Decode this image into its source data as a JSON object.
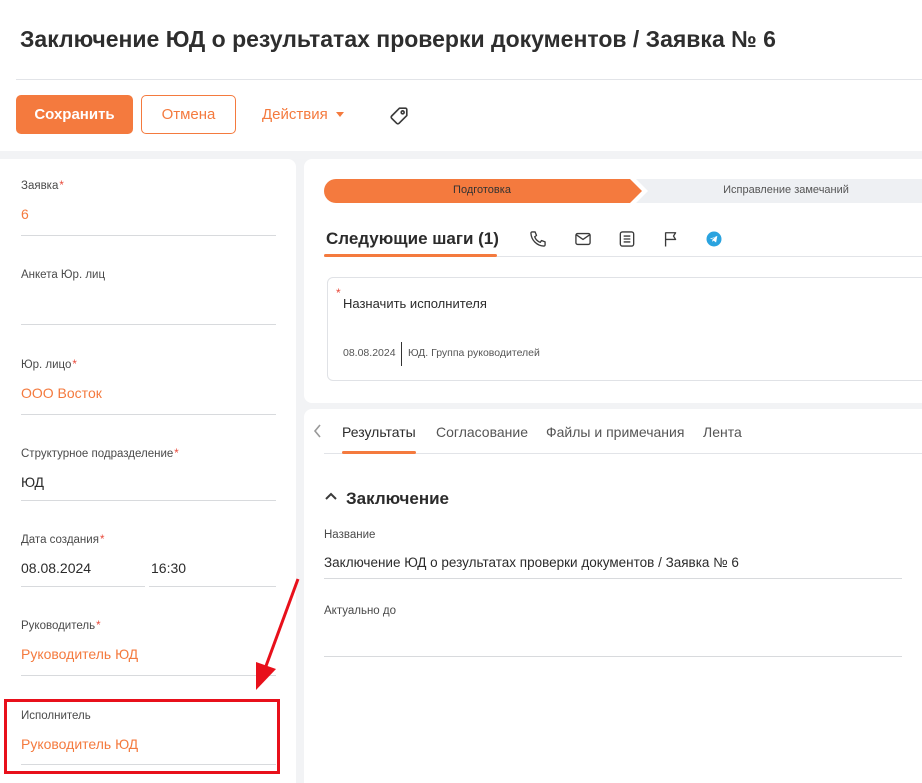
{
  "header": {
    "title": "Заключение ЮД о результатах проверки документов / Заявка № 6",
    "save_label": "Сохранить",
    "cancel_label": "Отмена",
    "actions_label": "Действия",
    "tag_icon": "tag-icon"
  },
  "left_form": {
    "fields": [
      {
        "label": "Заявка",
        "required": true,
        "value": "6"
      },
      {
        "label": "Анкета Юр. лиц",
        "required": false,
        "value": ""
      },
      {
        "label": "Юр. лицо",
        "required": true,
        "value": "ООО Восток"
      },
      {
        "label": "Структурное подразделение",
        "required": true,
        "value": "ЮД"
      },
      {
        "label": "Дата создания",
        "required": true,
        "date": "08.08.2024",
        "time": "16:30"
      },
      {
        "label": "Руководитель",
        "required": true,
        "value": "Руководитель ЮД"
      },
      {
        "label": "Исполнитель",
        "required": false,
        "value": "Руководитель ЮД"
      }
    ],
    "required_mark": "*"
  },
  "stages": {
    "active": "Подготовка",
    "next": "Исправление замечаний"
  },
  "next_steps": {
    "title": "Следующие шаги (1)",
    "icons": [
      "phone-icon",
      "mail-icon",
      "document-icon",
      "flag-icon",
      "telegram-icon"
    ],
    "task": {
      "required_mark": "*",
      "title": "Назначить исполнителя",
      "date": "08.08.2024",
      "group": "ЮД. Группа руководителей"
    }
  },
  "tabs": {
    "items": [
      "Результаты",
      "Согласование",
      "Файлы и примечания",
      "Лента"
    ],
    "active": "Результаты"
  },
  "section": {
    "title": "Заключение",
    "fields": [
      {
        "label": "Название",
        "value": "Заключение ЮД о результатах проверки документов / Заявка № 6"
      },
      {
        "label": "Актуально до",
        "value": ""
      }
    ]
  },
  "colors": {
    "accent": "#f47a3e",
    "annotation": "#e8101b",
    "required": "#e84a3b"
  }
}
